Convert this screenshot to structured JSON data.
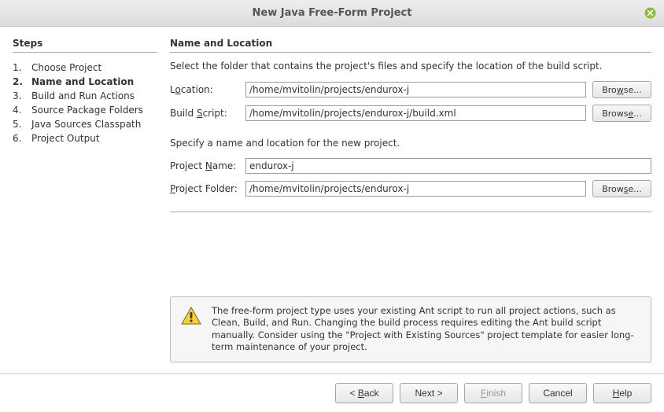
{
  "window": {
    "title": "New Java Free-Form Project"
  },
  "sidebar": {
    "heading": "Steps",
    "items": [
      {
        "num": "1.",
        "label": "Choose Project"
      },
      {
        "num": "2.",
        "label": "Name and Location"
      },
      {
        "num": "3.",
        "label": "Build and Run Actions"
      },
      {
        "num": "4.",
        "label": "Source Package Folders"
      },
      {
        "num": "5.",
        "label": "Java Sources Classpath"
      },
      {
        "num": "6.",
        "label": "Project Output"
      }
    ],
    "current_index": 1
  },
  "main": {
    "heading": "Name and Location",
    "intro": "Select the folder that contains the project's files and specify the location of the build script.",
    "location": {
      "label_pre": "L",
      "label_mn": "o",
      "label_post": "cation:",
      "value": "/home/mvitolin/projects/endurox-j",
      "browse_pre": "Bro",
      "browse_mn": "w",
      "browse_post": "se..."
    },
    "buildscript": {
      "label_pre": "Build ",
      "label_mn": "S",
      "label_post": "cript:",
      "value": "/home/mvitolin/projects/endurox-j/build.xml",
      "browse_pre": "Brows",
      "browse_mn": "e",
      "browse_post": "..."
    },
    "specify_text": "Specify a name and location for the new project.",
    "projectname": {
      "label_pre": "Project ",
      "label_mn": "N",
      "label_post": "ame:",
      "value": "endurox-j"
    },
    "projectfolder": {
      "label_pre": "",
      "label_mn": "P",
      "label_post": "roject Folder:",
      "value": "/home/mvitolin/projects/endurox-j",
      "browse_pre": "Brow",
      "browse_mn": "s",
      "browse_post": "e..."
    },
    "info": "The free-form project type uses your existing Ant script to run all project actions, such as Clean, Build, and Run. Changing the build process requires editing the Ant build script manually. Consider using the \"Project with Existing Sources\" project template for easier long-term maintenance of your  project."
  },
  "footer": {
    "back_pre": "< ",
    "back_mn": "B",
    "back_post": "ack",
    "next": "Next >",
    "finish_pre": "",
    "finish_mn": "F",
    "finish_post": "inish",
    "cancel": "Cancel",
    "help_pre": "",
    "help_mn": "H",
    "help_post": "elp"
  }
}
